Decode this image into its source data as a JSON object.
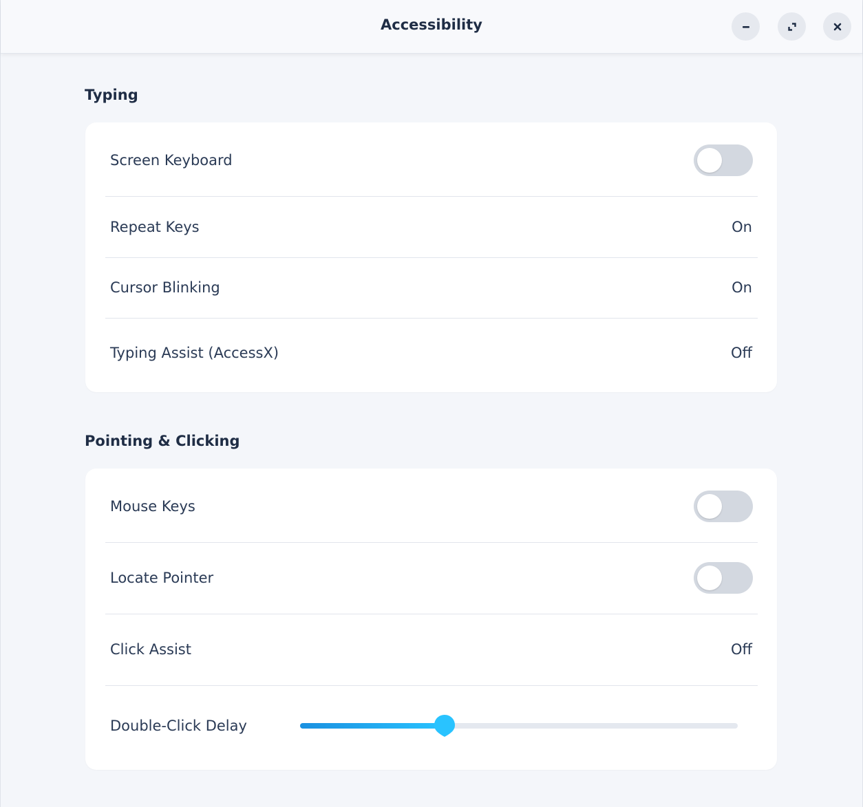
{
  "window": {
    "title": "Accessibility",
    "controls": {
      "minimize": "minimize-icon",
      "maximize": "maximize-icon",
      "close": "close-icon"
    }
  },
  "typing": {
    "heading": "Typing",
    "items": [
      {
        "label": "Screen Keyboard",
        "type": "toggle",
        "state": "off"
      },
      {
        "label": "Repeat Keys",
        "type": "value",
        "value": "On"
      },
      {
        "label": "Cursor Blinking",
        "type": "value",
        "value": "On"
      },
      {
        "label": "Typing Assist (AccessX)",
        "type": "value",
        "value": "Off"
      }
    ]
  },
  "pointing": {
    "heading": "Pointing & Clicking",
    "items": [
      {
        "label": "Mouse Keys",
        "type": "toggle",
        "state": "off"
      },
      {
        "label": "Locate Pointer",
        "type": "toggle",
        "state": "off"
      },
      {
        "label": "Click Assist",
        "type": "value",
        "value": "Off"
      },
      {
        "label": "Double-Click Delay",
        "type": "slider",
        "level": 0.33
      }
    ]
  },
  "colors": {
    "accent": "#29c3ff",
    "text": "#1f2d45",
    "toggle_off": "#d3d8e0",
    "background": "#f4f6fa"
  }
}
